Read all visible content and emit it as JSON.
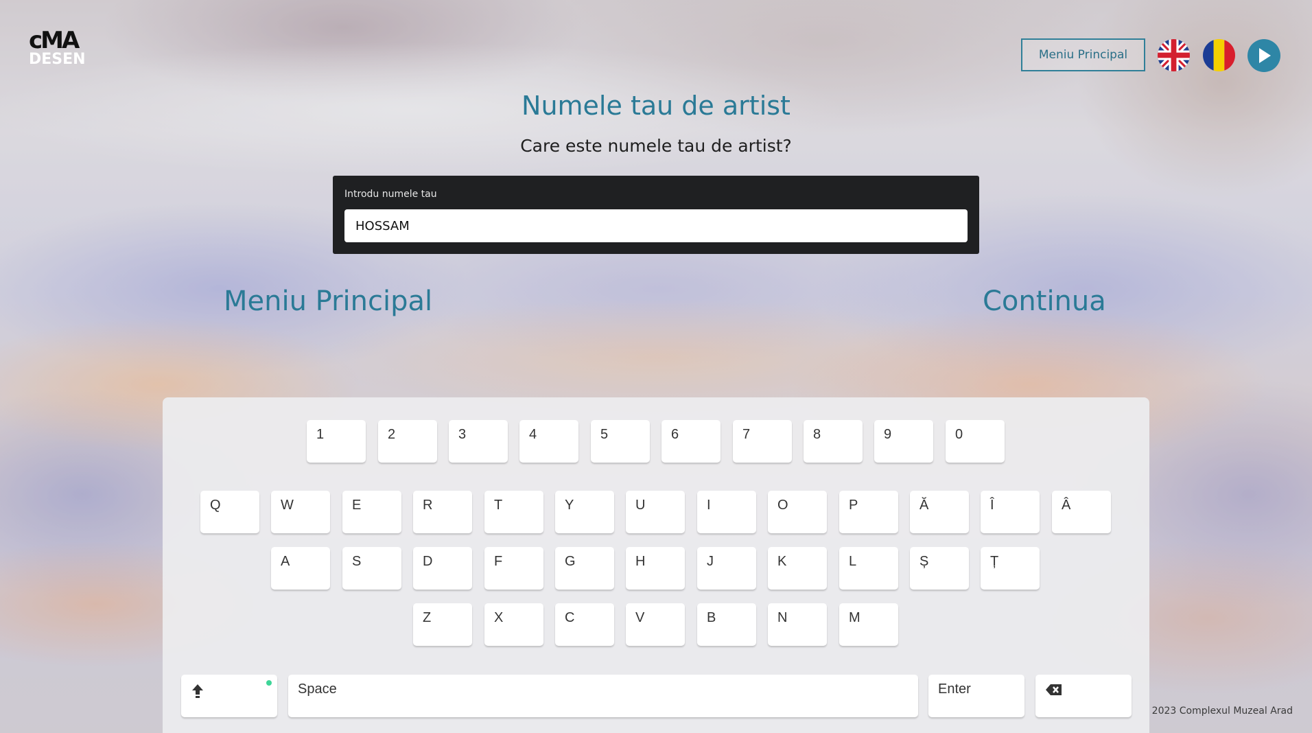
{
  "logo": {
    "mark": "cMA",
    "text": "DESEN"
  },
  "header": {
    "menu_button_label": "Meniu Principal",
    "languages": [
      {
        "name": "english-flag-icon"
      },
      {
        "name": "romanian-flag-icon"
      }
    ],
    "play_icon": "play-icon"
  },
  "main": {
    "title": "Numele tau de artist",
    "subtitle": "Care este numele tau de artist?",
    "input": {
      "label": "Introdu numele tau",
      "value": "HOSSAM"
    },
    "back_label": "Meniu Principal",
    "continue_label": "Continua"
  },
  "keyboard": {
    "row1": [
      "1",
      "2",
      "3",
      "4",
      "5",
      "6",
      "7",
      "8",
      "9",
      "0"
    ],
    "row2": [
      "Q",
      "W",
      "E",
      "R",
      "T",
      "Y",
      "U",
      "I",
      "O",
      "P",
      "Ă",
      "Î",
      "Â"
    ],
    "row3": [
      "A",
      "S",
      "D",
      "F",
      "G",
      "H",
      "J",
      "K",
      "L",
      "Ș",
      "Ț"
    ],
    "row4": [
      "Z",
      "X",
      "C",
      "V",
      "B",
      "N",
      "M"
    ],
    "space_label": "Space",
    "enter_label": "Enter",
    "shift_icon": "shift-icon",
    "backspace_icon": "backspace-icon"
  },
  "footer": {
    "copyright": "2023 Complexul Muzeal Arad"
  },
  "colors": {
    "accent": "#2a7a96",
    "shift_indicator": "#3ed598"
  }
}
